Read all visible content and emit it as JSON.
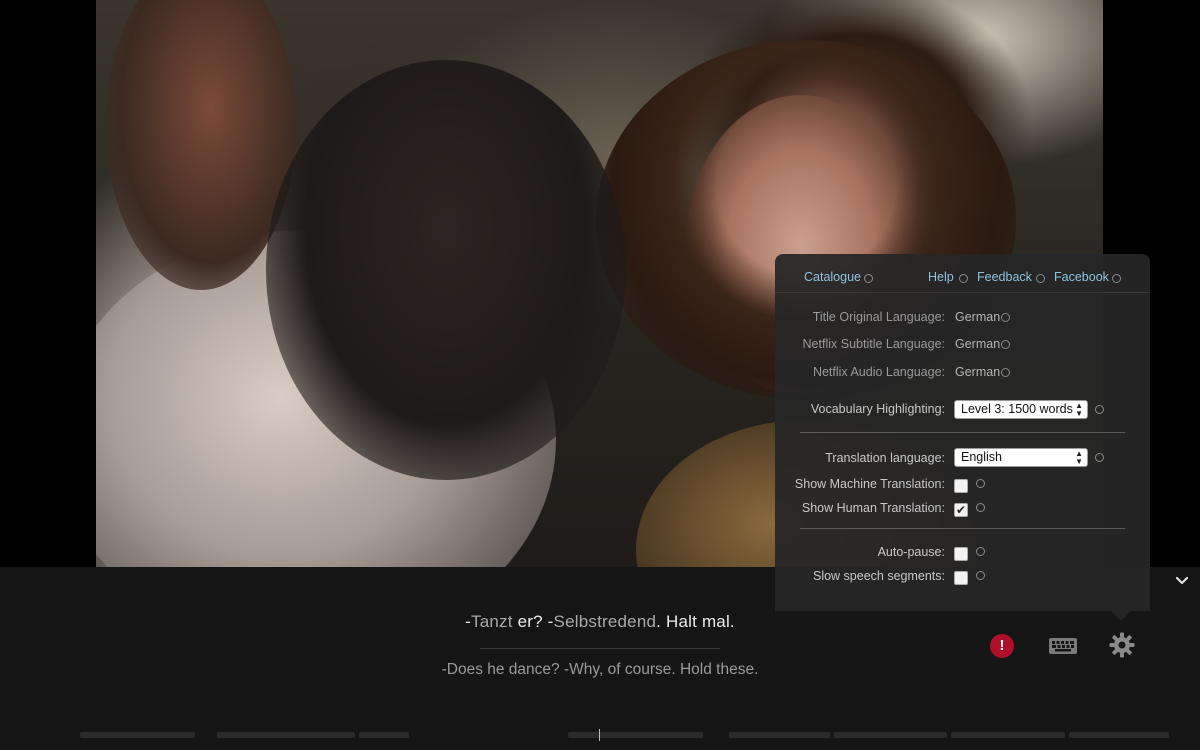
{
  "subtitle": {
    "part1": "-",
    "word1": "Tanzt",
    "part2": " er? -",
    "word2": "Selbstredend",
    "part3": ". Halt mal."
  },
  "translation": "-Does he dance? -Why, of course. Hold these.",
  "controls": {
    "alert_glyph": "!",
    "alert_color": "#b00f2c"
  },
  "panel": {
    "links": {
      "catalogue": "Catalogue",
      "help": "Help",
      "feedback": "Feedback",
      "facebook": "Facebook"
    },
    "rows": {
      "title_original_language_label": "Title Original Language:",
      "title_original_language_value": "German",
      "netflix_subtitle_language_label": "Netflix Subtitle Language:",
      "netflix_subtitle_language_value": "German",
      "netflix_audio_language_label": "Netflix Audio Language:",
      "netflix_audio_language_value": "German",
      "vocabulary_highlighting_label": "Vocabulary Highlighting:",
      "vocabulary_highlighting_value": "Level 3: 1500 words",
      "translation_language_label": "Translation language:",
      "translation_language_value": "English",
      "show_machine_translation_label": "Show Machine Translation:",
      "show_machine_translation_checked": false,
      "show_human_translation_label": "Show Human Translation:",
      "show_human_translation_checked": true,
      "auto_pause_label": "Auto-pause:",
      "auto_pause_checked": false,
      "slow_speech_segments_label": "Slow speech segments:",
      "slow_speech_segments_checked": false
    },
    "checkmark": "✔"
  },
  "colors": {
    "link": "#8fc3dc",
    "highlighted_word": "#a9a9a9",
    "bar_bg": "#151515"
  }
}
